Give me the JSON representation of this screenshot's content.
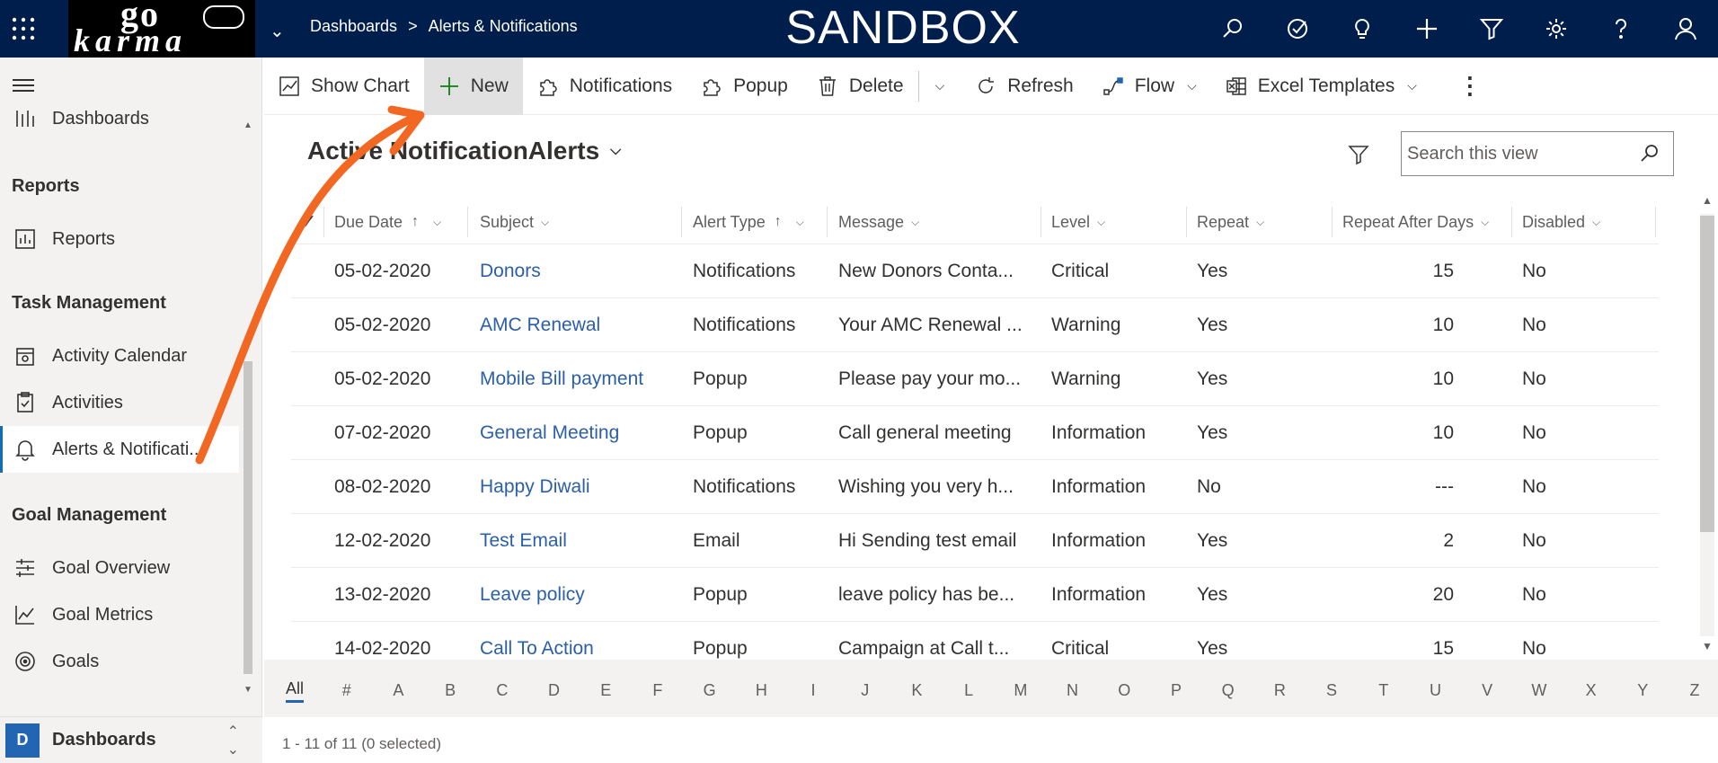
{
  "app": {
    "environment_title": "SANDBOX",
    "logo_text_top": "go",
    "logo_text_bottom": "karma",
    "breadcrumb": [
      "Dashboards",
      "Alerts & Notifications"
    ],
    "breadcrumb_sep": ">"
  },
  "top_icons": [
    "search-icon",
    "task-icon",
    "lightbulb-icon",
    "plus-icon",
    "filter-icon",
    "gear-icon",
    "help-icon",
    "user-icon"
  ],
  "sidebar": {
    "partial_item": "Dashboards",
    "sections": [
      {
        "title": "Reports",
        "items": [
          {
            "label": "Reports",
            "icon": "report-icon"
          }
        ]
      },
      {
        "title": "Task Management",
        "items": [
          {
            "label": "Activity Calendar",
            "icon": "calendar-icon"
          },
          {
            "label": "Activities",
            "icon": "clipboard-icon"
          },
          {
            "label": "Alerts & Notificati...",
            "icon": "bell-icon",
            "active": true
          }
        ]
      },
      {
        "title": "Goal Management",
        "items": [
          {
            "label": "Goal Overview",
            "icon": "goal-overview-icon"
          },
          {
            "label": "Goal Metrics",
            "icon": "metrics-icon"
          },
          {
            "label": "Goals",
            "icon": "target-icon"
          }
        ]
      }
    ],
    "area_badge": "D",
    "area_label": "Dashboards"
  },
  "command_bar": {
    "show_chart": "Show Chart",
    "new": "New",
    "notifications": "Notifications",
    "popup": "Popup",
    "delete": "Delete",
    "refresh": "Refresh",
    "flow": "Flow",
    "excel_templates": "Excel Templates",
    "more": "⋮"
  },
  "view": {
    "title": "Active NotificationAlerts",
    "search_placeholder": "Search this view"
  },
  "grid": {
    "columns": [
      "Due Date",
      "Subject",
      "Alert Type",
      "Message",
      "Level",
      "Repeat",
      "Repeat After Days",
      "Disabled"
    ],
    "rows": [
      [
        "05-02-2020",
        "Donors",
        "Notifications",
        "New Donors Conta...",
        "Critical",
        "Yes",
        "15",
        "No"
      ],
      [
        "05-02-2020",
        "AMC Renewal",
        "Notifications",
        "Your AMC Renewal ...",
        "Warning",
        "Yes",
        "10",
        "No"
      ],
      [
        "05-02-2020",
        "Mobile Bill payment",
        "Popup",
        "Please pay your mo...",
        "Warning",
        "Yes",
        "10",
        "No"
      ],
      [
        "07-02-2020",
        "General Meeting",
        "Popup",
        "Call general meeting",
        "Information",
        "Yes",
        "10",
        "No"
      ],
      [
        "08-02-2020",
        "Happy Diwali",
        "Notifications",
        "Wishing you very h...",
        "Information",
        "No",
        "---",
        "No"
      ],
      [
        "12-02-2020",
        "Test Email",
        "Email",
        "Hi Sending test email",
        "Information",
        "Yes",
        "2",
        "No"
      ],
      [
        "13-02-2020",
        "Leave policy",
        "Popup",
        "leave policy has be...",
        "Information",
        "Yes",
        "20",
        "No"
      ],
      [
        "14-02-2020",
        "Call To Action",
        "Popup",
        "Campaign at Call t...",
        "Critical",
        "Yes",
        "15",
        "No"
      ]
    ]
  },
  "alphabet": [
    "All",
    "#",
    "A",
    "B",
    "C",
    "D",
    "E",
    "F",
    "G",
    "H",
    "I",
    "J",
    "K",
    "L",
    "M",
    "N",
    "O",
    "P",
    "Q",
    "R",
    "S",
    "T",
    "U",
    "V",
    "W",
    "X",
    "Y",
    "Z"
  ],
  "status": "1 - 11 of 11 (0 selected)",
  "colors": {
    "header_bg": "#001e4b",
    "link": "#2b5fa8",
    "annotation_arrow": "#f26722",
    "accent": "#2266b3"
  }
}
